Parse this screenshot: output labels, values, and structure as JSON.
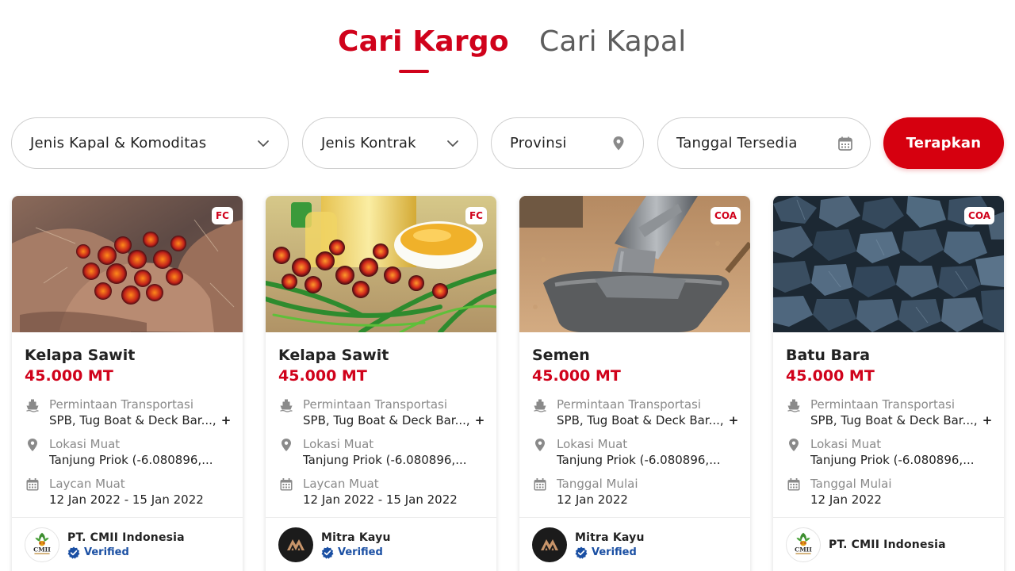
{
  "tabs": {
    "cargo": "Cari Kargo",
    "ship": "Cari Kapal"
  },
  "filters": {
    "vessel_commodity": "Jenis Kapal & Komoditas",
    "contract": "Jenis Kontrak",
    "province": "Provinsi",
    "date": "Tanggal Tersedia",
    "apply": "Terapkan"
  },
  "colors": {
    "accent": "#d0021b",
    "verified": "#1a4fa3"
  },
  "cards": [
    {
      "badge": "FC",
      "title": "Kelapa Sawit",
      "quantity": "45.000 MT",
      "transport_label": "Permintaan Transportasi",
      "transport_value": "SPB, Tug Boat & Deck Bar...,",
      "transport_extra": "+1",
      "location_label": "Lokasi Muat",
      "location_value": "Tanjung Priok (-6.080896,...",
      "date_label": "Laycan Muat",
      "date_value": "12 Jan 2022 - 15 Jan 2022",
      "company": "PT. CMII Indonesia",
      "verified": "Verified",
      "image": "palm-fruit-hands"
    },
    {
      "badge": "FC",
      "title": "Kelapa Sawit",
      "quantity": "45.000 MT",
      "transport_label": "Permintaan Transportasi",
      "transport_value": "SPB, Tug Boat & Deck Bar...,",
      "transport_extra": "+1",
      "location_label": "Lokasi Muat",
      "location_value": "Tanjung Priok (-6.080896,...",
      "date_label": "Laycan Muat",
      "date_value": "12 Jan 2022 - 15 Jan 2022",
      "company": "Mitra Kayu",
      "verified": "Verified",
      "image": "palm-oil-bottle"
    },
    {
      "badge": "COA",
      "title": "Semen",
      "quantity": "45.000 MT",
      "transport_label": "Permintaan Transportasi",
      "transport_value": "SPB, Tug Boat & Deck Bar...,",
      "transport_extra": "+1",
      "location_label": "Lokasi Muat",
      "location_value": "Tanjung Priok (-6.080896,...",
      "date_label": "Tanggal Mulai",
      "date_value": "12 Jan 2022",
      "company": "Mitra Kayu",
      "verified": "Verified",
      "image": "cement-pour"
    },
    {
      "badge": "COA",
      "title": "Batu Bara",
      "quantity": "45.000 MT",
      "transport_label": "Permintaan Transportasi",
      "transport_value": "SPB, Tug Boat & Deck Bar...,",
      "transport_extra": "+1",
      "location_label": "Lokasi Muat",
      "location_value": "Tanjung Priok (-6.080896,...",
      "date_label": "Tanggal Mulai",
      "date_value": "12 Jan 2022",
      "company": "PT. CMII Indonesia",
      "image": "coal-pile"
    }
  ]
}
